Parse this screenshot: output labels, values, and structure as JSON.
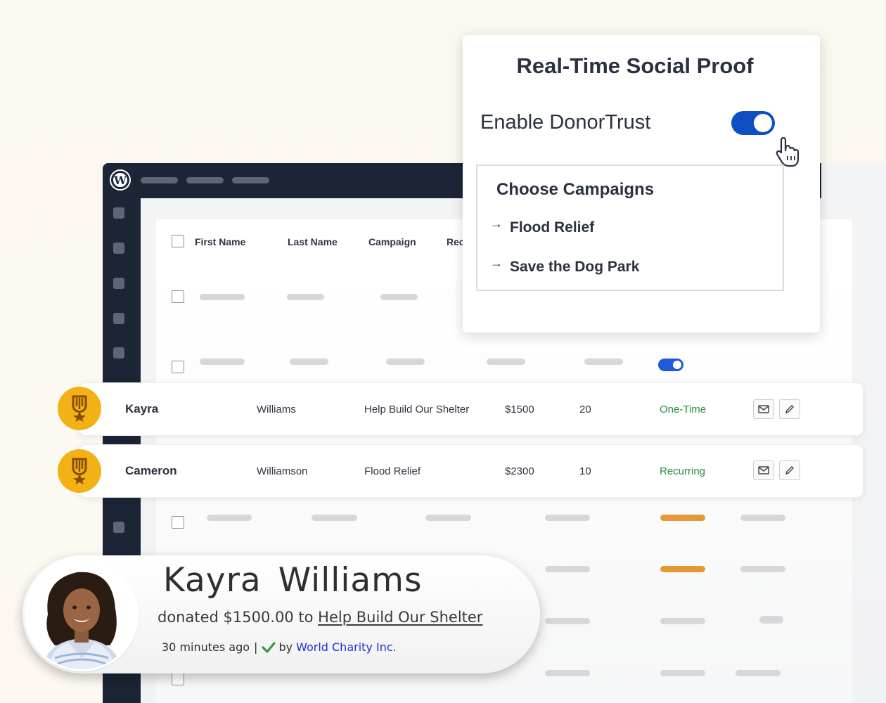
{
  "table": {
    "headers": [
      "First Name",
      "Last Name",
      "Campaign",
      "Rec"
    ]
  },
  "donors": [
    {
      "first": "Kayra",
      "last": "Williams",
      "campaign": "Help Build Our Shelter",
      "amount": "$1500",
      "count": "20",
      "type": "One-Time"
    },
    {
      "first": "Cameron",
      "last": "Williamson",
      "campaign": "Flood Relief",
      "amount": "$2300",
      "count": "10",
      "type": "Recurring"
    }
  ],
  "popup": {
    "title": "Real-Time Social Proof",
    "enable_label": "Enable DonorTrust",
    "enabled": true,
    "campaigns_title": "Choose Campaigns",
    "campaigns": [
      "Flood Relief",
      "Save the Dog Park"
    ],
    "arrow": "→"
  },
  "notification": {
    "first": "Kayra",
    "last": "Williams",
    "donated_prefix": "donated $1500.00 to",
    "campaign": "Help Build Our Shelter",
    "time": "30 minutes ago",
    "separator": "|",
    "by": "by",
    "org": "World Charity Inc."
  },
  "colors": {
    "admin_bar": "#1c2536",
    "toggle_on": "#0e4fc4",
    "badge": "#f2b216",
    "type_green": "#2e8b3a",
    "link_blue": "#2131d6"
  },
  "icons": {
    "logo": "wordpress-logo-icon",
    "badge": "award-ribbon-icon",
    "email": "envelope-icon",
    "edit": "pencil-icon",
    "cursor": "hand-pointer-icon",
    "verified": "checkmark-icon"
  }
}
